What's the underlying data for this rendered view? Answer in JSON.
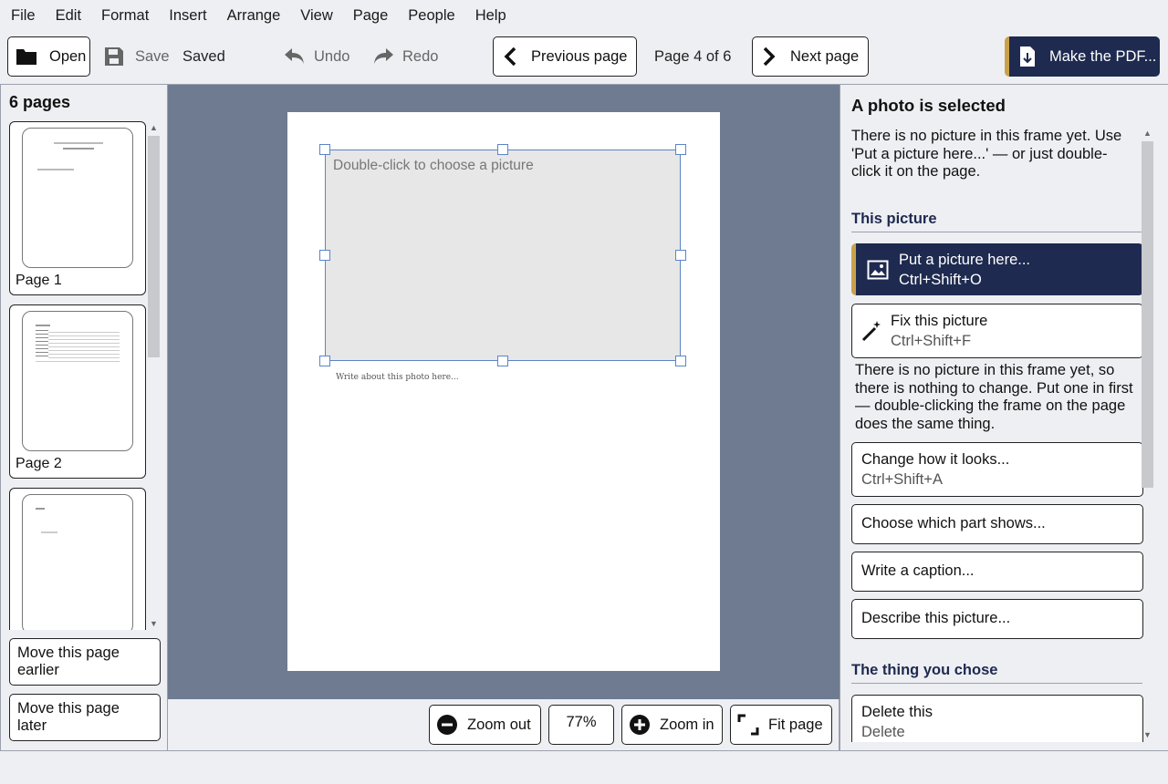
{
  "menu": [
    "File",
    "Edit",
    "Format",
    "Insert",
    "Arrange",
    "View",
    "Page",
    "People",
    "Help"
  ],
  "toolbar": {
    "open_label": "Open",
    "save_label": "Save",
    "saved_status": "Saved",
    "undo_label": "Undo",
    "redo_label": "Redo",
    "prev_label": "Previous page",
    "page_indicator": "Page 4 of 6",
    "next_label": "Next page",
    "pdf_label": "Make the PDF..."
  },
  "pages_panel": {
    "heading": "6 pages",
    "thumbs": [
      {
        "label": "Page 1"
      },
      {
        "label": "Page 2"
      },
      {
        "label": ""
      }
    ],
    "move_earlier": "Move this page earlier",
    "move_later": "Move this page later"
  },
  "canvas": {
    "frame_hint": "Double-click to choose a picture",
    "caption_placeholder": "Write about this photo here..."
  },
  "zoom": {
    "zoom_out_label": "Zoom out",
    "level": "77%",
    "zoom_in_label": "Zoom in",
    "fit_label": "Fit page"
  },
  "inspector": {
    "title": "A photo is selected",
    "description": "There is no picture in this frame yet. Use 'Put a picture here...' — or just double-click it on the page.",
    "section_picture": "This picture",
    "put_picture": {
      "label": "Put a picture here...",
      "shortcut": "Ctrl+Shift+O"
    },
    "fix_picture": {
      "label": "Fix this picture",
      "shortcut": "Ctrl+Shift+F"
    },
    "fix_note": "There is no picture in this frame yet, so there is nothing to change. Put one in first — double-clicking the frame on the page does the same thing.",
    "change_looks": {
      "label": "Change how it looks...",
      "shortcut": "Ctrl+Shift+A"
    },
    "choose_part": "Choose which part shows...",
    "write_caption": "Write a caption...",
    "describe": "Describe this picture...",
    "section_thing": "The thing you chose",
    "delete": {
      "label": "Delete this",
      "shortcut": "Delete"
    }
  },
  "colors": {
    "accent_navy": "#1e2a4f",
    "accent_gold": "#c9a14a",
    "canvas_bg": "#6e7b91",
    "selection_blue": "#5b85c6"
  }
}
